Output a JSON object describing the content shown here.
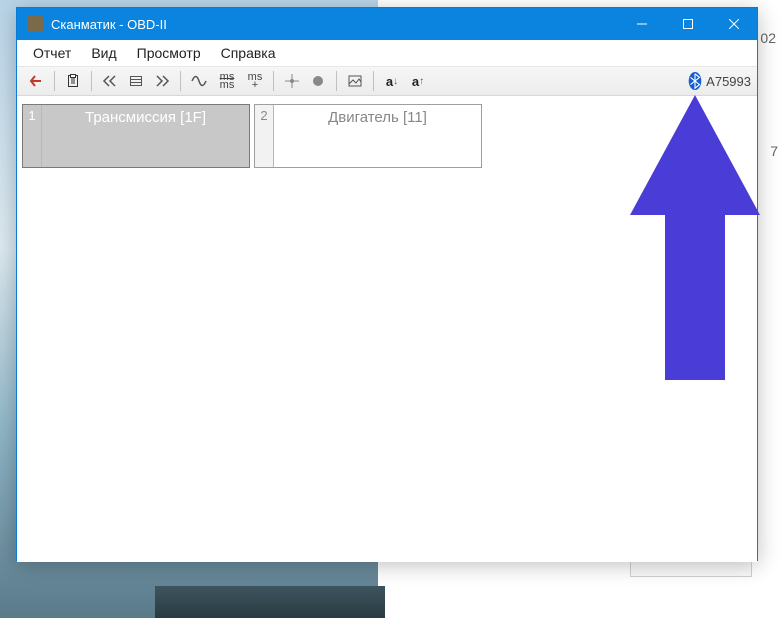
{
  "background": {
    "right_top": "02",
    "right_mid": "7"
  },
  "window": {
    "title": "Сканматик - OBD-II",
    "menu": [
      "Отчет",
      "Вид",
      "Просмотр",
      "Справка"
    ],
    "toolbar": {
      "icons": [
        "back-arrow",
        "clipboard",
        "rewind",
        "list",
        "forward",
        "sine",
        "ms",
        "ms-plus",
        "crosshair",
        "record",
        "image",
        "font-down",
        "font-up"
      ]
    },
    "bluetooth": "A75993",
    "nodes": [
      {
        "n": "1",
        "label": "Трансмиссия [1F]",
        "selected": true
      },
      {
        "n": "2",
        "label": "Двигатель [11]",
        "selected": false
      }
    ]
  }
}
